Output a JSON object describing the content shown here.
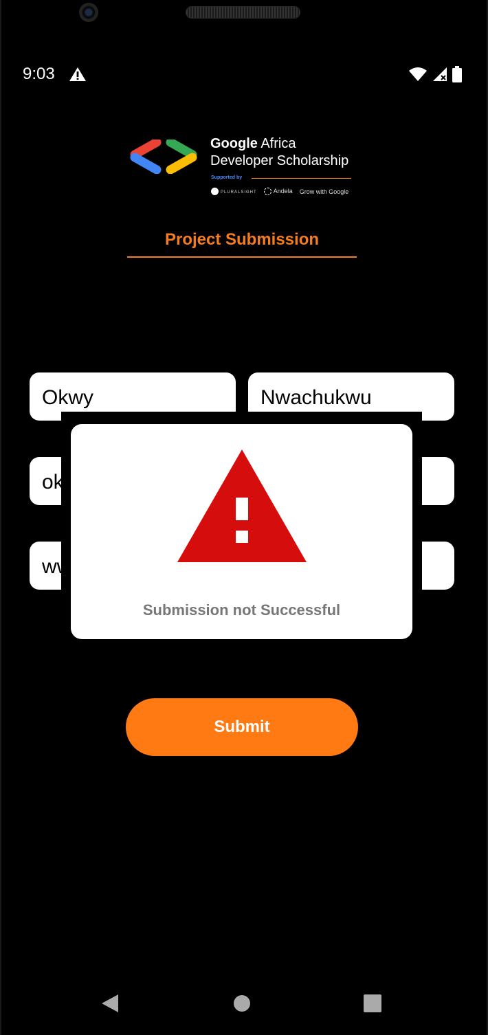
{
  "status_bar": {
    "time": "9:03",
    "icons": [
      "warning-icon",
      "wifi-icon",
      "signal-icon",
      "battery-icon"
    ]
  },
  "logo": {
    "title_bold": "Google",
    "title_rest": " Africa",
    "subtitle": "Developer Scholarship",
    "supported_by": "Supported by",
    "partners": [
      "PLURALSIGHT",
      "Andela",
      "Grow with Google"
    ]
  },
  "page": {
    "title": "Project Submission"
  },
  "form": {
    "first_name": "Okwy",
    "last_name": "Nwachukwu",
    "email": "okwy",
    "github_link": "www"
  },
  "submit_label": "Submit",
  "dialog": {
    "icon": "warning-triangle-icon",
    "message": "Submission not Successful"
  },
  "nav": {
    "icons": [
      "back-icon",
      "home-icon",
      "recents-icon"
    ]
  },
  "colors": {
    "accent": "#f57c1f",
    "button": "#ff7a13",
    "error": "#d50d0d",
    "dialog_text": "#777777"
  }
}
